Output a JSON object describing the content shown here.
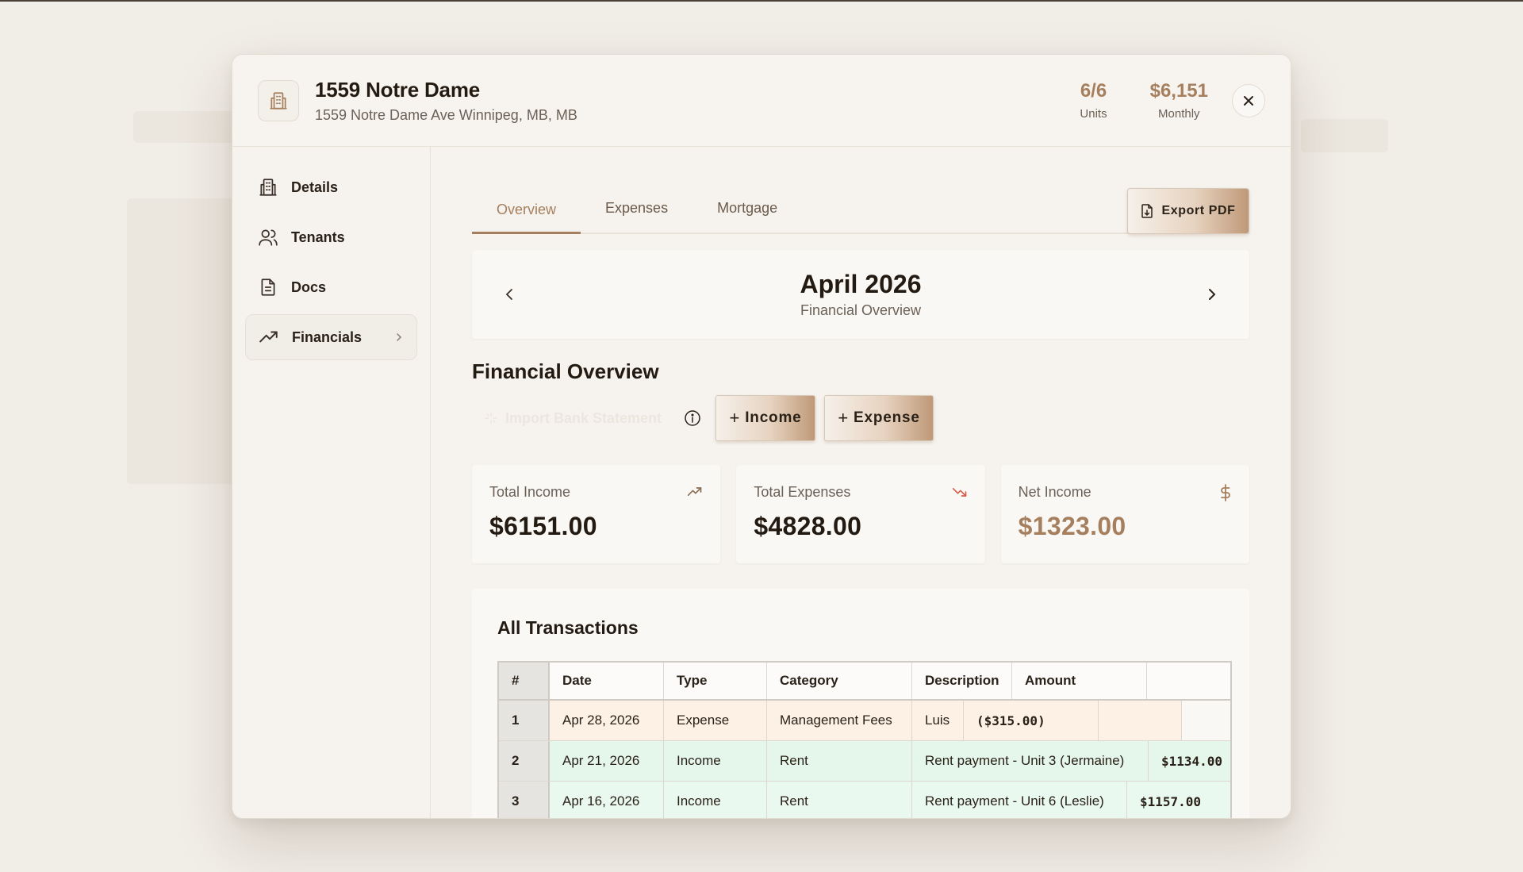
{
  "property": {
    "name": "1559 Notre Dame",
    "address": "1559 Notre Dame Ave Winnipeg, MB, MB",
    "units_value": "6/6",
    "units_label": "Units",
    "monthly_value": "$6,151",
    "monthly_label": "Monthly"
  },
  "sidebar": {
    "items": [
      {
        "label": "Details",
        "icon": "building-icon"
      },
      {
        "label": "Tenants",
        "icon": "users-icon"
      },
      {
        "label": "Docs",
        "icon": "document-icon"
      },
      {
        "label": "Financials",
        "icon": "trending-up-icon",
        "active": true
      }
    ]
  },
  "tabs": [
    {
      "label": "Overview",
      "active": true
    },
    {
      "label": "Expenses"
    },
    {
      "label": "Mortgage"
    }
  ],
  "export_label": "Export PDF",
  "period": {
    "month": "April 2026",
    "subtitle": "Financial Overview"
  },
  "financial": {
    "title": "Financial Overview",
    "import_label": "Import Bank Statement",
    "income_button": "Income",
    "expense_button": "Expense"
  },
  "stats": {
    "total_income_label": "Total Income",
    "total_income": "$6151.00",
    "total_expenses_label": "Total Expenses",
    "total_expenses": "$4828.00",
    "net_income_label": "Net Income",
    "net_income": "$1323.00"
  },
  "transactions": {
    "title": "All Transactions",
    "headers": [
      "#",
      "Date",
      "Type",
      "Category",
      "Description",
      "Amount"
    ],
    "rows": [
      {
        "n": "1",
        "date": "Apr 28, 2026",
        "type": "Expense",
        "category": "Management Fees",
        "description": "Luis",
        "amount": "($315.00)"
      },
      {
        "n": "2",
        "date": "Apr 21, 2026",
        "type": "Income",
        "category": "Rent",
        "description": "Rent payment - Unit 3 (Jermaine)",
        "amount": "$1134.00"
      },
      {
        "n": "3",
        "date": "Apr 16, 2026",
        "type": "Income",
        "category": "Rent",
        "description": "Rent payment - Unit 6 (Leslie)",
        "amount": "$1157.00"
      }
    ]
  },
  "colors": {
    "accent": "#a57f5e",
    "expense_row": "#fcf1e4",
    "income_row": "#e5f7ea",
    "expense_trend": "#d2604a"
  }
}
